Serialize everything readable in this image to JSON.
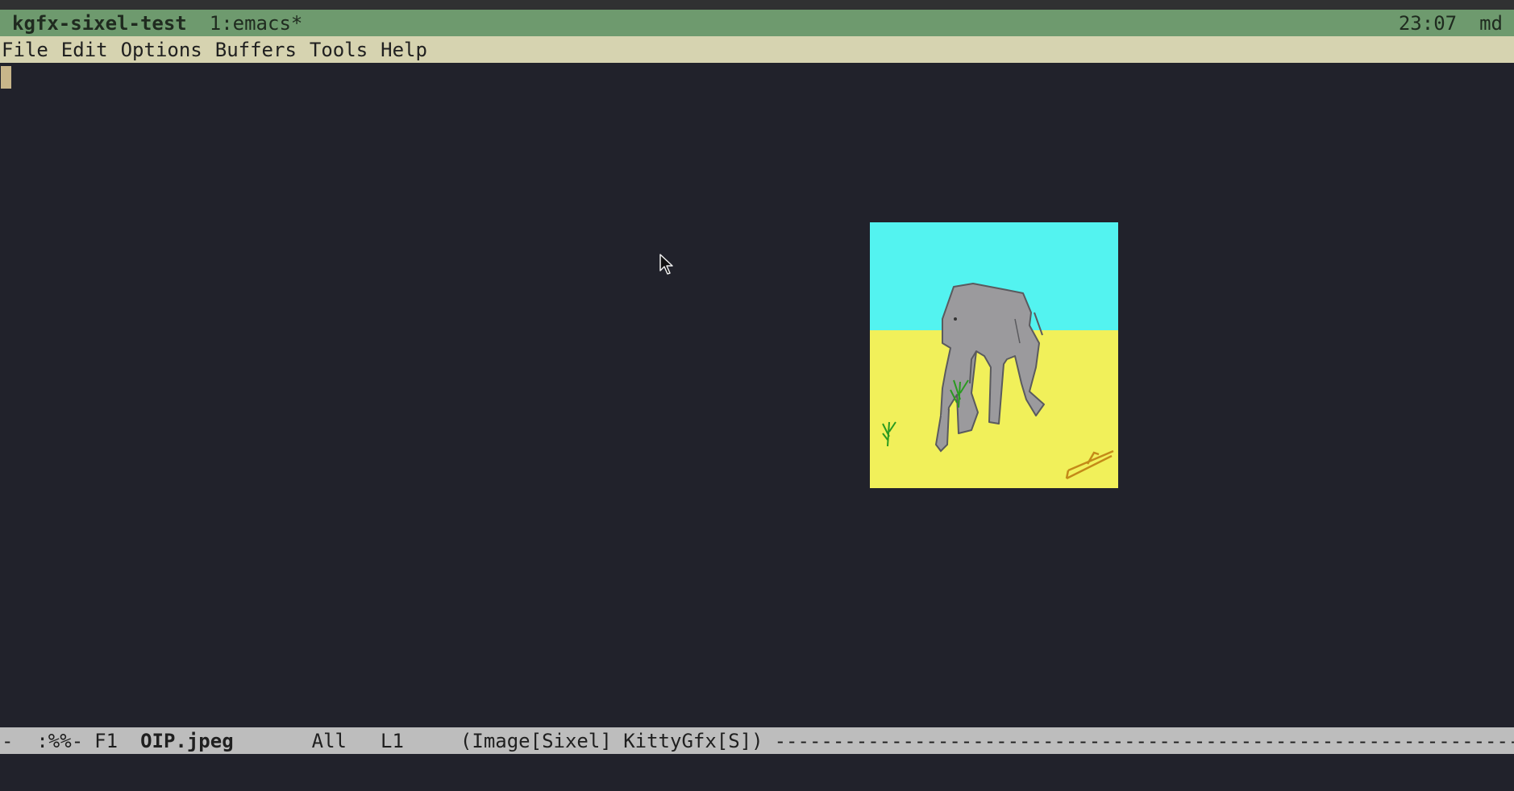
{
  "tmux": {
    "session_name": "kgfx-sixel-test",
    "window": "1:emacs*",
    "clock": "23:07",
    "host": "md"
  },
  "menu": {
    "items": [
      {
        "label": "File"
      },
      {
        "label": "Edit"
      },
      {
        "label": "Options"
      },
      {
        "label": "Buffers"
      },
      {
        "label": "Tools"
      },
      {
        "label": "Help"
      }
    ]
  },
  "mode_line": {
    "status": "-  :%%-",
    "frame": "F1",
    "buffer_name": "OIP.jpeg",
    "position": "All",
    "line": "L1",
    "major_mode": "(Image[Sixel] KittyGfx[S])",
    "fill": "--------------------------------------------------------------------------------------------------"
  },
  "image": {
    "sky_color": "#53f3f0",
    "ground_color": "#f1f05a",
    "elephant_color": "#9b9a9d"
  },
  "colors": {
    "background": "#21222b",
    "tmux_bar": "#6e9a6e",
    "menu_bar": "#d6d3b0",
    "mode_line": "#bdbdbd",
    "cursor": "#c8b68a"
  }
}
